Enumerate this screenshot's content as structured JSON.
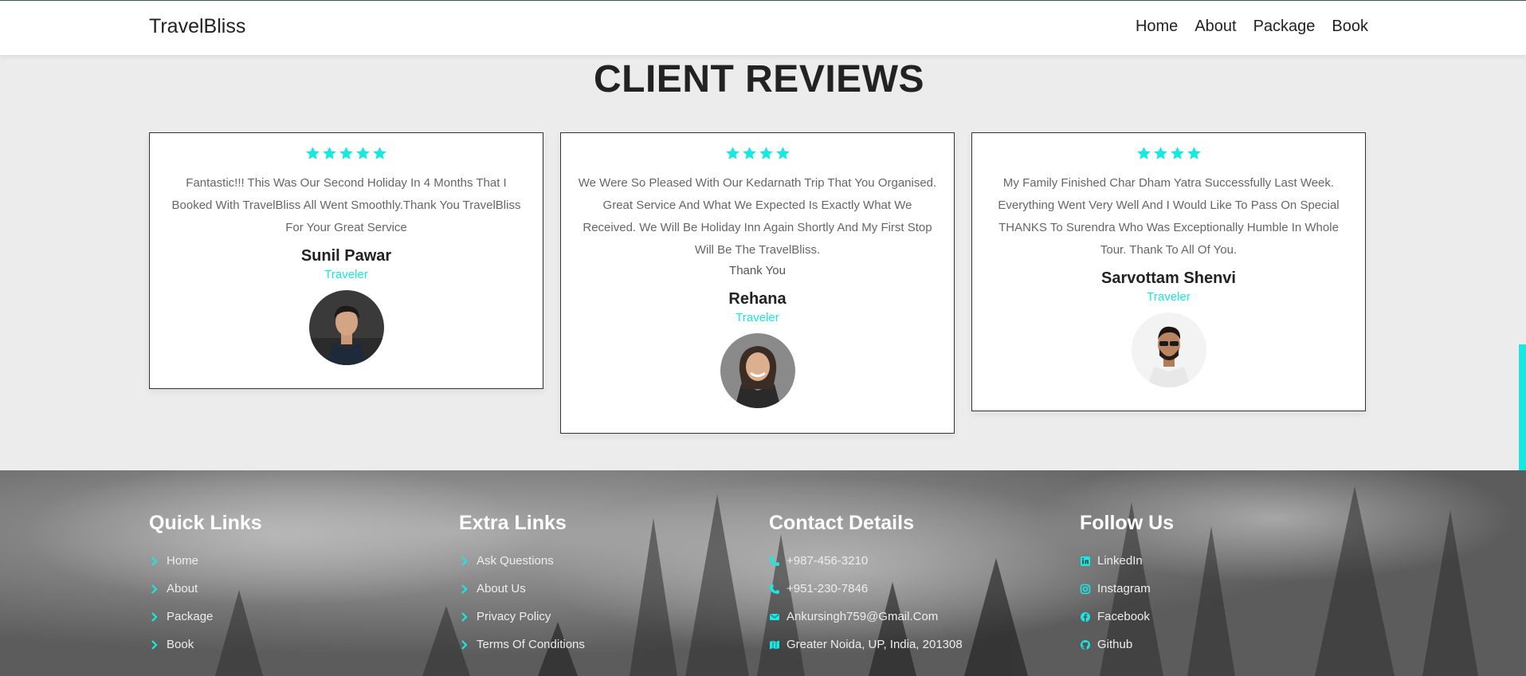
{
  "header": {
    "brand": "TravelBliss",
    "nav": [
      "Home",
      "About",
      "Package",
      "Book"
    ]
  },
  "section_title": "CLIENT REVIEWS",
  "reviews": [
    {
      "rating": 5,
      "text": "Fantastic!!! This Was Our Second Holiday In 4 Months That I Booked With TravelBliss All Went Smoothly.Thank You TravelBliss For Your Great Service",
      "extra": "",
      "name": "Sunil Pawar",
      "role": "Traveler"
    },
    {
      "rating": 4,
      "text": "We Were So Pleased With Our Kedarnath Trip That You Organised. Great Service And What We Expected Is Exactly What We Received. We Will Be Holiday Inn Again Shortly And My First Stop Will Be The TravelBliss.",
      "extra": "Thank You",
      "name": "Rehana",
      "role": "Traveler"
    },
    {
      "rating": 4,
      "text": "My Family Finished Char Dham Yatra Successfully Last Week. Everything Went Very Well And I Would Like To Pass On Special THANKS To Surendra Who Was Exceptionally Humble In Whole Tour. Thank To All Of You.",
      "extra": "",
      "name": "Sarvottam Shenvi",
      "role": "Traveler"
    }
  ],
  "footer": {
    "quick_links": {
      "title": "Quick Links",
      "items": [
        "Home",
        "About",
        "Package",
        "Book"
      ]
    },
    "extra_links": {
      "title": "Extra Links",
      "items": [
        "Ask Questions",
        "About Us",
        "Privacy Policy",
        "Terms Of Conditions"
      ]
    },
    "contact": {
      "title": "Contact Details",
      "items": [
        {
          "icon": "phone-icon",
          "text": "+987-456-3210"
        },
        {
          "icon": "phone-icon",
          "text": "+951-230-7846"
        },
        {
          "icon": "envelope-icon",
          "text": "Ankursingh759@Gmail.Com"
        },
        {
          "icon": "map-icon",
          "text": "Greater Noida, UP, India, 201308"
        }
      ]
    },
    "follow": {
      "title": "Follow Us",
      "items": [
        {
          "icon": "linkedin-icon",
          "text": "LinkedIn"
        },
        {
          "icon": "instagram-icon",
          "text": "Instagram"
        },
        {
          "icon": "facebook-icon",
          "text": "Facebook"
        },
        {
          "icon": "github-icon",
          "text": "Github"
        }
      ]
    }
  },
  "colors": {
    "accent": "#18e7e2",
    "page_bg": "#ececec",
    "text": "#222222"
  }
}
